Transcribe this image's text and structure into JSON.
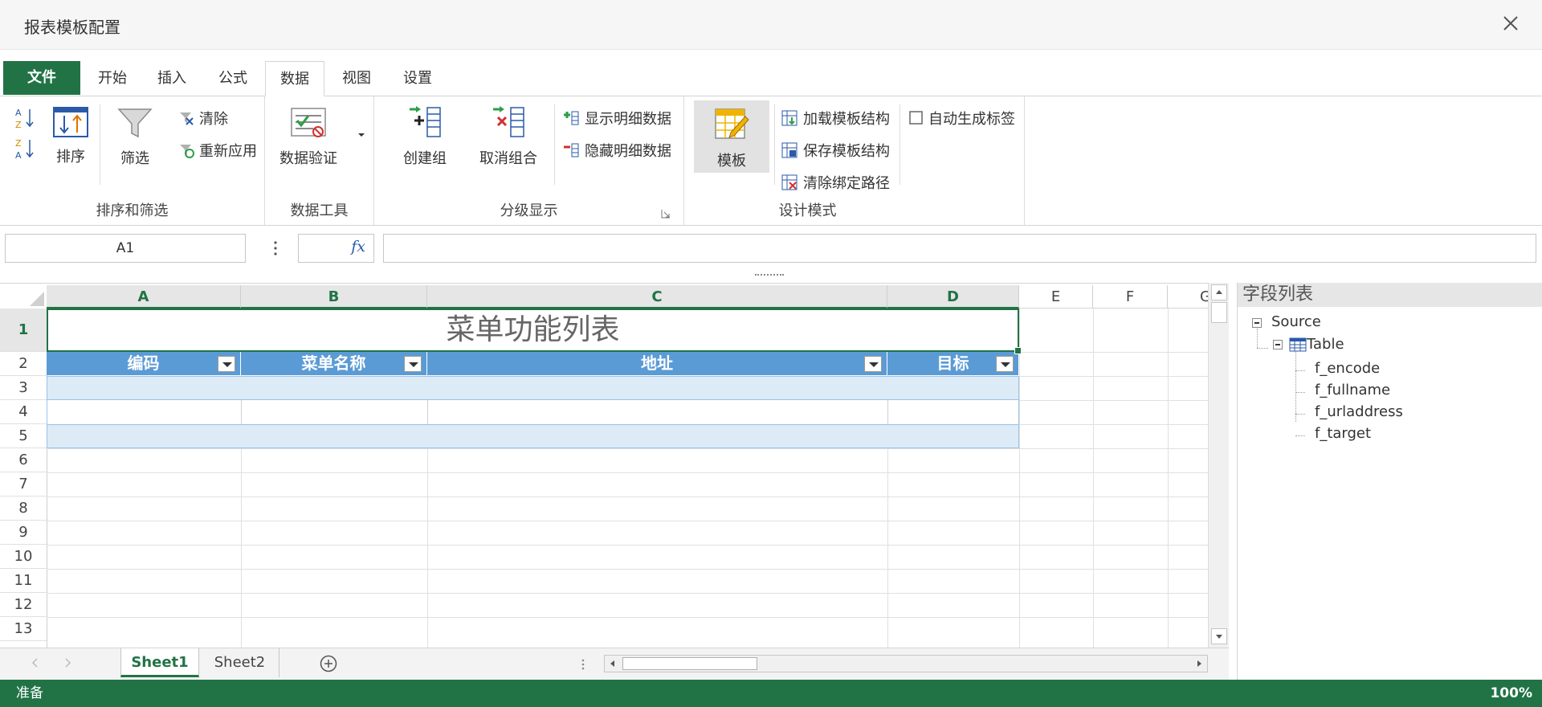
{
  "dialog": {
    "title": "报表模板配置",
    "close_icon": "close-icon"
  },
  "tabs": [
    {
      "label": "文件"
    },
    {
      "label": "开始"
    },
    {
      "label": "插入"
    },
    {
      "label": "公式"
    },
    {
      "label": "数据",
      "active": true
    },
    {
      "label": "视图"
    },
    {
      "label": "设置"
    }
  ],
  "ribbon": {
    "sort_filter": {
      "group_label": "排序和筛选",
      "sort": "排序",
      "filter": "筛选",
      "clear": "清除",
      "reapply": "重新应用"
    },
    "data_tools": {
      "group_label": "数据工具",
      "data_validation": "数据验证"
    },
    "outline": {
      "group_label": "分级显示",
      "group": "创建组",
      "ungroup": "取消组合",
      "show_detail": "显示明细数据",
      "hide_detail": "隐藏明细数据"
    },
    "design": {
      "group_label": "设计模式",
      "template": "模板",
      "load_template": "加载模板结构",
      "save_template": "保存模板结构",
      "clear_binding": "清除绑定路径",
      "auto_label": "自动生成标签",
      "auto_label_checked": false
    }
  },
  "formula_bar": {
    "name_box": "A1",
    "fx": "fx",
    "formula": ""
  },
  "sheet": {
    "columns": [
      "A",
      "B",
      "C",
      "D",
      "E",
      "F",
      "G"
    ],
    "rows": [
      "1",
      "2",
      "3",
      "4",
      "5",
      "6",
      "7",
      "8",
      "9",
      "10",
      "11",
      "12",
      "13"
    ],
    "title": "菜单功能列表",
    "headers": [
      "编码",
      "菜单名称",
      "地址",
      "目标"
    ],
    "header_color": "#5b9bd5",
    "band_color": "#ddebf7",
    "accent_color": "#217346"
  },
  "field_list": {
    "title": "字段列表",
    "source": "Source",
    "table": "Table",
    "fields": [
      "f_encode",
      "f_fullname",
      "f_urladdress",
      "f_target"
    ]
  },
  "sheet_tabs": [
    "Sheet1",
    "Sheet2"
  ],
  "status": {
    "left": "准备",
    "zoom": "100%"
  }
}
